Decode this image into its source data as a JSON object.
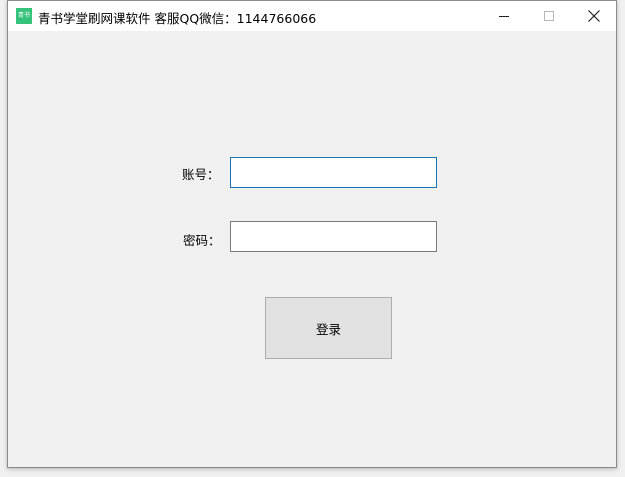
{
  "window": {
    "title": "青书学堂刷网课软件 客服QQ微信：1144766066",
    "icon_text": "青书",
    "icon": "app-logo-icon",
    "controls": {
      "minimize_icon": "minimize-icon",
      "maximize_icon": "maximize-icon",
      "close_icon": "close-icon"
    }
  },
  "form": {
    "account_label": "账号：",
    "account_value": "",
    "password_label": "密码：",
    "password_value": "",
    "login_label": "登录"
  },
  "colors": {
    "background": "#f0f0f0",
    "titlebar": "#ffffff",
    "focus_border": "#1874b5",
    "button_face": "#e1e1e1",
    "app_icon": "#35c27a"
  }
}
